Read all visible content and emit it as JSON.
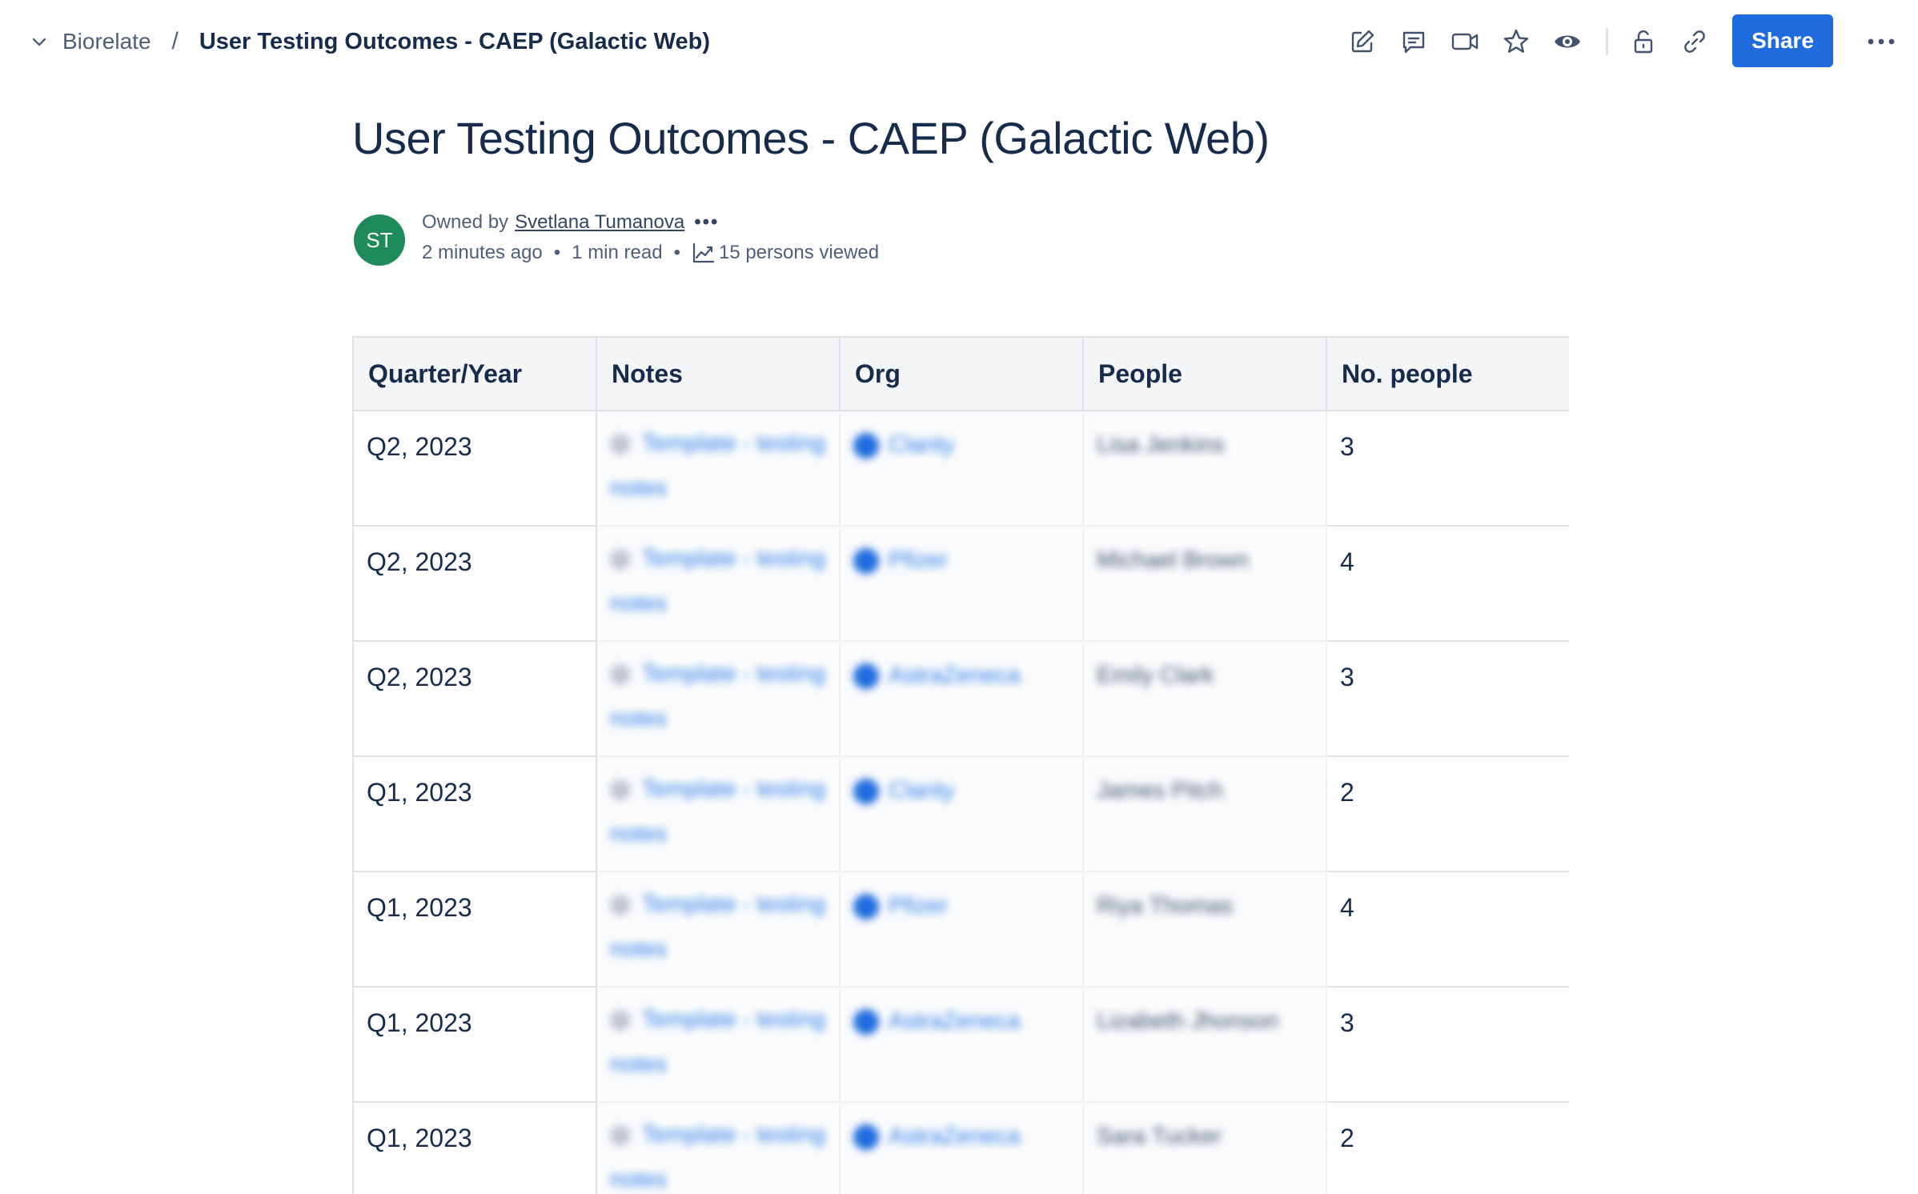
{
  "breadcrumb": {
    "space": "Biorelate",
    "separator": "/",
    "page": "User Testing Outcomes - CAEP (Galactic Web)"
  },
  "toolbar": {
    "icons": [
      "edit-icon",
      "comment-icon",
      "video-icon",
      "star-icon",
      "watch-icon",
      "unlock-icon",
      "link-icon"
    ],
    "share_label": "Share",
    "more_icon": "more-horizontal-icon"
  },
  "page": {
    "title": "User Testing Outcomes - CAEP (Galactic Web)"
  },
  "byline": {
    "avatar_initials": "ST",
    "avatar_color": "#1f8a5b",
    "owned_by": "Owned by",
    "owner": "Svetlana Tumanova",
    "more": "•••",
    "updated": "2 minutes ago",
    "read_time": "1 min read",
    "views": "15 persons viewed"
  },
  "table": {
    "headers": [
      "Quarter/Year",
      "Notes",
      "Org",
      "People",
      "No. people"
    ],
    "rows": [
      {
        "quarter": "Q2, 2023",
        "notes": "Template - testing notes",
        "org": "Clarity",
        "people": "Lisa Jenkins",
        "count": "3"
      },
      {
        "quarter": "Q2, 2023",
        "notes": "Template - testing notes",
        "org": "Pfizer",
        "people": "Michael Brown",
        "count": "4"
      },
      {
        "quarter": "Q2, 2023",
        "notes": "Template - testing notes",
        "org": "AstraZeneca",
        "people": "Emily Clark",
        "count": "3"
      },
      {
        "quarter": "Q1, 2023",
        "notes": "Template - testing notes",
        "org": "Clarity",
        "people": "James Pitch",
        "count": "2"
      },
      {
        "quarter": "Q1, 2023",
        "notes": "Template - testing notes",
        "org": "Pfizer",
        "people": "Riya Thomas",
        "count": "4"
      },
      {
        "quarter": "Q1, 2023",
        "notes": "Template - testing notes",
        "org": "AstraZeneca",
        "people": "Lizabeth Jhonson",
        "count": "3"
      },
      {
        "quarter": "Q1, 2023",
        "notes": "Template - testing notes",
        "org": "AstraZeneca",
        "people": "Sara Tucker",
        "count": "2"
      }
    ]
  },
  "colors": {
    "accent": "#1f6bde",
    "link": "#2b7de9",
    "header_bg": "#f4f5f7",
    "border": "#dfe1e6"
  }
}
